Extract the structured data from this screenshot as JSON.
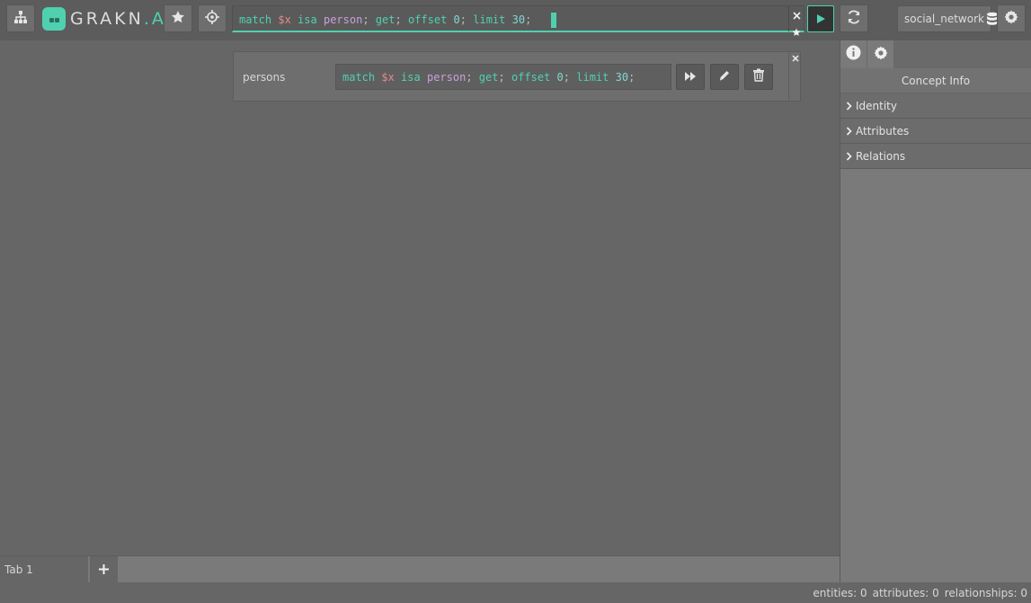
{
  "brand": {
    "logo_main": "GRAKN",
    "logo_accent": ".AI"
  },
  "toolbar": {
    "schema_button_icon": "schema-tree-icon",
    "favourites_button_icon": "star-icon",
    "types_button_icon": "crosshair-icon",
    "run_button_icon": "play-icon",
    "reload_button_icon": "refresh-icon",
    "settings_button_icon": "gear-icon"
  },
  "editor": {
    "query": {
      "kw_match": "match",
      "var": "$x",
      "isa": "isa",
      "type": "person",
      "semi1": ";",
      "kw_get": "get",
      "semi2": ";",
      "kw_offset": "offset",
      "offset": "0",
      "semi3": ";",
      "kw_limit": "limit",
      "limit": "30",
      "semi4": ";"
    },
    "clear_icon": "close-icon",
    "add_favourite_icon": "star-icon"
  },
  "keyspace": {
    "name": "social_network",
    "icon": "database-icon"
  },
  "favourite_query": {
    "name": "persons",
    "query": {
      "kw_match": "match",
      "var": "$x",
      "isa": "isa",
      "type": "person",
      "semi1": ";",
      "kw_get": "get",
      "semi2": ";",
      "kw_offset": "offset",
      "offset": "0",
      "semi3": ";",
      "kw_limit": "limit",
      "limit": "30",
      "semi4": ";"
    },
    "run_icon": "fast-forward-icon",
    "edit_icon": "pencil-icon",
    "delete_icon": "trash-icon",
    "close_icon": "close-icon"
  },
  "right_panel": {
    "tabs": [
      {
        "icon": "info-icon"
      },
      {
        "icon": "gear-icon"
      }
    ],
    "title": "Concept Info",
    "sections": [
      {
        "label": "Identity"
      },
      {
        "label": "Attributes"
      },
      {
        "label": "Relations"
      }
    ]
  },
  "tabs": {
    "items": [
      {
        "label": "Tab 1"
      }
    ],
    "add_icon": "plus-icon"
  },
  "status": {
    "entities": "entities: 0",
    "attributes": "attributes: 0",
    "relationships": "relationships: 0"
  },
  "colors": {
    "accent": "#4fd1b0",
    "background": "#666666",
    "toolbar": "#5c5c5c"
  }
}
